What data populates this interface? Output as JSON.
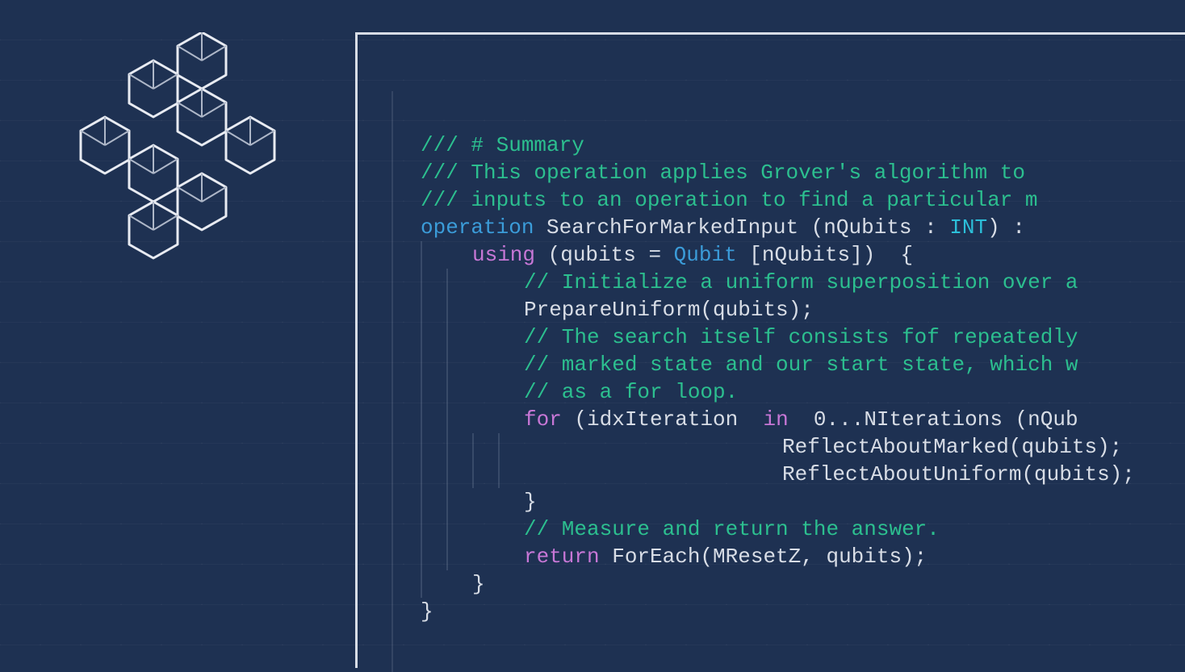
{
  "logo": {
    "semantic": "cube-cluster-logo"
  },
  "colors": {
    "background": "#1e3152",
    "commentGreen": "#2cbf8f",
    "keywordBlue": "#3b9cd9",
    "keywordMagenta": "#c777d6",
    "text": "#d8dde6",
    "typeCyan": "#2cbfd9"
  },
  "code": {
    "lines": [
      {
        "indent": 0,
        "guides": [],
        "tokens": [
          {
            "cls": "tok-comment-green",
            "t": "/// # Summary"
          }
        ]
      },
      {
        "indent": 0,
        "guides": [],
        "tokens": [
          {
            "cls": "tok-comment-green",
            "t": "/// This operation applies Grover's algorithm to "
          }
        ]
      },
      {
        "indent": 0,
        "guides": [],
        "tokens": [
          {
            "cls": "tok-comment-green",
            "t": "/// inputs to an operation to find a particular m"
          }
        ]
      },
      {
        "indent": 0,
        "guides": [],
        "tokens": [
          {
            "cls": "tok-kw-blue",
            "t": "operation "
          },
          {
            "cls": "tok-plain",
            "t": "SearchForMarkedInput (nQubits : "
          },
          {
            "cls": "tok-type-cyan",
            "t": "INT"
          },
          {
            "cls": "tok-plain",
            "t": ") : "
          }
        ]
      },
      {
        "indent": 1,
        "guides": [
          0
        ],
        "tokens": [
          {
            "cls": "tok-kw-magenta",
            "t": "using "
          },
          {
            "cls": "tok-plain",
            "t": "(qubits = "
          },
          {
            "cls": "tok-kw-blue",
            "t": "Qubit "
          },
          {
            "cls": "tok-plain",
            "t": "[nQubits])  {"
          }
        ]
      },
      {
        "indent": 2,
        "guides": [
          0,
          1
        ],
        "tokens": [
          {
            "cls": "tok-comment-green",
            "t": "// Initialize a uniform superposition over a"
          }
        ]
      },
      {
        "indent": 2,
        "guides": [
          0,
          1
        ],
        "tokens": [
          {
            "cls": "tok-plain",
            "t": "PrepareUniform(qubits);"
          }
        ]
      },
      {
        "indent": 2,
        "guides": [
          0,
          1
        ],
        "tokens": [
          {
            "cls": "tok-comment-green",
            "t": "// The search itself consists fof repeatedly"
          }
        ]
      },
      {
        "indent": 2,
        "guides": [
          0,
          1
        ],
        "tokens": [
          {
            "cls": "tok-comment-green",
            "t": "// marked state and our start state, which w"
          }
        ]
      },
      {
        "indent": 2,
        "guides": [
          0,
          1
        ],
        "tokens": [
          {
            "cls": "tok-comment-green",
            "t": "// as a for loop."
          }
        ]
      },
      {
        "indent": 2,
        "guides": [
          0,
          1
        ],
        "tokens": [
          {
            "cls": "tok-kw-magenta",
            "t": "for "
          },
          {
            "cls": "tok-plain",
            "t": "(idxIteration  "
          },
          {
            "cls": "tok-kw-magenta",
            "t": "in  "
          },
          {
            "cls": "tok-plain",
            "t": "0..."
          },
          {
            "cls": "tok-plain",
            "t": "NIterations (nQub"
          }
        ]
      },
      {
        "indent": 7,
        "guides": [
          0,
          1,
          2,
          3
        ],
        "tokens": [
          {
            "cls": "tok-plain",
            "t": "ReflectAboutMarked(qubits);"
          }
        ]
      },
      {
        "indent": 7,
        "guides": [
          0,
          1,
          2,
          3
        ],
        "tokens": [
          {
            "cls": "tok-plain",
            "t": "ReflectAboutUniform(qubits);"
          }
        ]
      },
      {
        "indent": 2,
        "guides": [
          0,
          1
        ],
        "tokens": [
          {
            "cls": "tok-plain",
            "t": "}"
          }
        ]
      },
      {
        "indent": 2,
        "guides": [
          0,
          1
        ],
        "tokens": [
          {
            "cls": "tok-comment-green",
            "t": "// Measure and return the answer."
          }
        ]
      },
      {
        "indent": 2,
        "guides": [
          0,
          1
        ],
        "tokens": [
          {
            "cls": "tok-kw-magenta",
            "t": "return "
          },
          {
            "cls": "tok-plain",
            "t": "ForEach(MResetZ, qubits);"
          }
        ]
      },
      {
        "indent": 1,
        "guides": [
          0
        ],
        "tokens": [
          {
            "cls": "tok-plain",
            "t": "}"
          }
        ]
      },
      {
        "indent": 0,
        "guides": [],
        "tokens": [
          {
            "cls": "tok-plain",
            "t": "}"
          }
        ]
      }
    ]
  }
}
